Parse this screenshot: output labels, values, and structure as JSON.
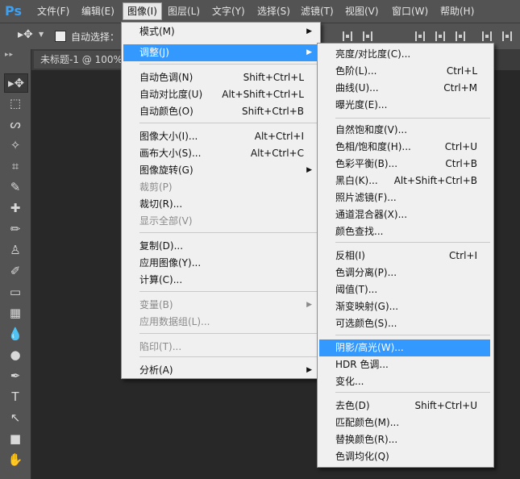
{
  "app": {
    "logo": "Ps"
  },
  "menubar": [
    {
      "label": "文件(F)",
      "active": false
    },
    {
      "label": "编辑(E)",
      "active": false
    },
    {
      "label": "图像(I)",
      "active": true
    },
    {
      "label": "图层(L)",
      "active": false
    },
    {
      "label": "文字(Y)",
      "active": false
    },
    {
      "label": "选择(S)",
      "active": false
    },
    {
      "label": "滤镜(T)",
      "active": false
    },
    {
      "label": "视图(V)",
      "active": false
    },
    {
      "label": "窗口(W)",
      "active": false
    },
    {
      "label": "帮助(H)",
      "active": false
    }
  ],
  "options_bar": {
    "auto_select_label": "自动选择：",
    "auto_select_checked": false
  },
  "document": {
    "tab_label": "未标题-1 @ 100%"
  },
  "tools": [
    "move-tool",
    "marquee-tool",
    "lasso-tool",
    "magic-wand-tool",
    "crop-tool",
    "eyedropper-tool",
    "healing-brush-tool",
    "brush-tool",
    "clone-stamp-tool",
    "history-brush-tool",
    "eraser-tool",
    "gradient-tool",
    "blur-tool",
    "dodge-tool",
    "pen-tool",
    "type-tool",
    "path-selection-tool",
    "rectangle-tool",
    "hand-tool"
  ],
  "image_menu": {
    "items": [
      {
        "label": "模式(M)",
        "shortcut": "",
        "submenu": true,
        "disabled": false,
        "highlighted": false
      },
      {
        "label": "调整(J)",
        "shortcut": "",
        "submenu": true,
        "disabled": false,
        "highlighted": true
      },
      {
        "label": "自动色调(N)",
        "shortcut": "Shift+Ctrl+L",
        "submenu": false,
        "disabled": false,
        "highlighted": false
      },
      {
        "label": "自动对比度(U)",
        "shortcut": "Alt+Shift+Ctrl+L",
        "submenu": false,
        "disabled": false,
        "highlighted": false
      },
      {
        "label": "自动颜色(O)",
        "shortcut": "Shift+Ctrl+B",
        "submenu": false,
        "disabled": false,
        "highlighted": false
      },
      {
        "label": "图像大小(I)...",
        "shortcut": "Alt+Ctrl+I",
        "submenu": false,
        "disabled": false,
        "highlighted": false
      },
      {
        "label": "画布大小(S)...",
        "shortcut": "Alt+Ctrl+C",
        "submenu": false,
        "disabled": false,
        "highlighted": false
      },
      {
        "label": "图像旋转(G)",
        "shortcut": "",
        "submenu": true,
        "disabled": false,
        "highlighted": false
      },
      {
        "label": "裁剪(P)",
        "shortcut": "",
        "submenu": false,
        "disabled": true,
        "highlighted": false
      },
      {
        "label": "裁切(R)...",
        "shortcut": "",
        "submenu": false,
        "disabled": false,
        "highlighted": false
      },
      {
        "label": "显示全部(V)",
        "shortcut": "",
        "submenu": false,
        "disabled": true,
        "highlighted": false
      },
      {
        "label": "复制(D)...",
        "shortcut": "",
        "submenu": false,
        "disabled": false,
        "highlighted": false
      },
      {
        "label": "应用图像(Y)...",
        "shortcut": "",
        "submenu": false,
        "disabled": false,
        "highlighted": false
      },
      {
        "label": "计算(C)...",
        "shortcut": "",
        "submenu": false,
        "disabled": false,
        "highlighted": false
      },
      {
        "label": "变量(B)",
        "shortcut": "",
        "submenu": true,
        "disabled": true,
        "highlighted": false
      },
      {
        "label": "应用数据组(L)...",
        "shortcut": "",
        "submenu": false,
        "disabled": true,
        "highlighted": false
      },
      {
        "label": "陷印(T)...",
        "shortcut": "",
        "submenu": false,
        "disabled": true,
        "highlighted": false
      },
      {
        "label": "分析(A)",
        "shortcut": "",
        "submenu": true,
        "disabled": false,
        "highlighted": false
      }
    ]
  },
  "adjust_menu": {
    "items": [
      {
        "label": "亮度/对比度(C)...",
        "shortcut": "",
        "highlighted": false
      },
      {
        "label": "色阶(L)...",
        "shortcut": "Ctrl+L",
        "highlighted": false
      },
      {
        "label": "曲线(U)...",
        "shortcut": "Ctrl+M",
        "highlighted": false
      },
      {
        "label": "曝光度(E)...",
        "shortcut": "",
        "highlighted": false
      },
      {
        "label": "自然饱和度(V)...",
        "shortcut": "",
        "highlighted": false
      },
      {
        "label": "色相/饱和度(H)...",
        "shortcut": "Ctrl+U",
        "highlighted": false
      },
      {
        "label": "色彩平衡(B)...",
        "shortcut": "Ctrl+B",
        "highlighted": false
      },
      {
        "label": "黑白(K)...",
        "shortcut": "Alt+Shift+Ctrl+B",
        "highlighted": false
      },
      {
        "label": "照片滤镜(F)...",
        "shortcut": "",
        "highlighted": false
      },
      {
        "label": "通道混合器(X)...",
        "shortcut": "",
        "highlighted": false
      },
      {
        "label": "颜色查找...",
        "shortcut": "",
        "highlighted": false
      },
      {
        "label": "反相(I)",
        "shortcut": "Ctrl+I",
        "highlighted": false
      },
      {
        "label": "色调分离(P)...",
        "shortcut": "",
        "highlighted": false
      },
      {
        "label": "阈值(T)...",
        "shortcut": "",
        "highlighted": false
      },
      {
        "label": "渐变映射(G)...",
        "shortcut": "",
        "highlighted": false
      },
      {
        "label": "可选颜色(S)...",
        "shortcut": "",
        "highlighted": false
      },
      {
        "label": "阴影/高光(W)...",
        "shortcut": "",
        "highlighted": true
      },
      {
        "label": "HDR 色调...",
        "shortcut": "",
        "highlighted": false
      },
      {
        "label": "变化...",
        "shortcut": "",
        "highlighted": false
      },
      {
        "label": "去色(D)",
        "shortcut": "Shift+Ctrl+U",
        "highlighted": false
      },
      {
        "label": "匹配颜色(M)...",
        "shortcut": "",
        "highlighted": false
      },
      {
        "label": "替换颜色(R)...",
        "shortcut": "",
        "highlighted": false
      },
      {
        "label": "色调均化(Q)",
        "shortcut": "",
        "highlighted": false
      }
    ]
  },
  "colors": {
    "highlight": "#3399ff",
    "menu_bg": "#f0f0f0",
    "chrome": "#535353",
    "canvas": "#282828"
  }
}
